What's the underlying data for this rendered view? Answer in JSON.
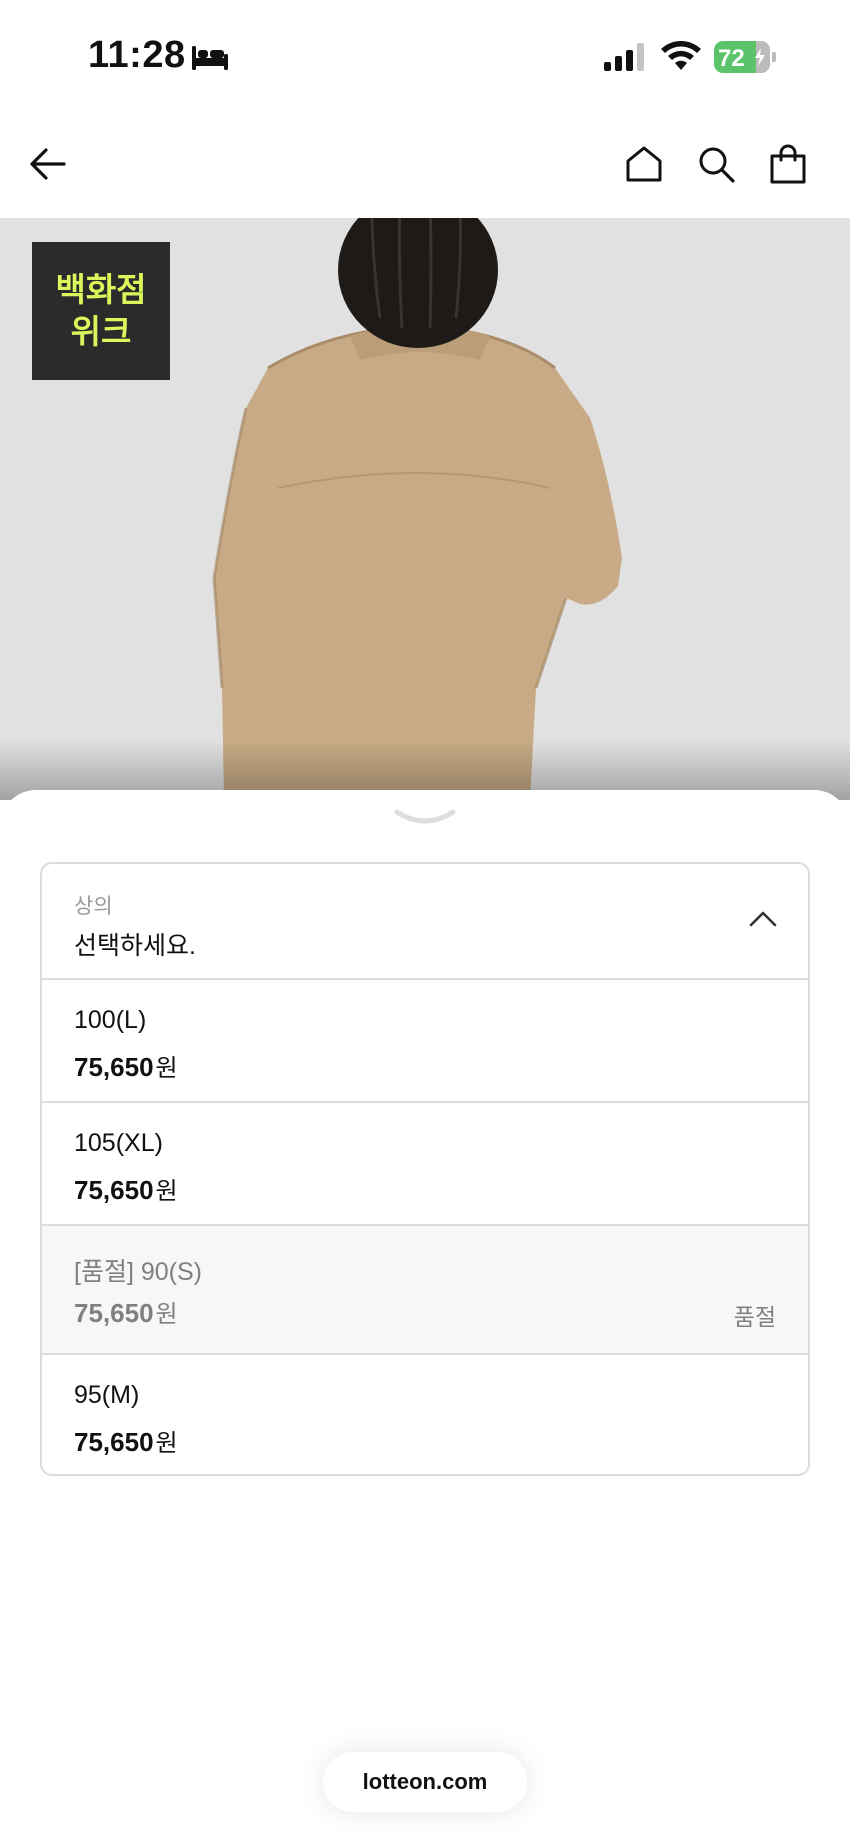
{
  "status_bar": {
    "time": "11:28",
    "battery_level": "72",
    "battery_charging": true,
    "icons": [
      "bed-icon",
      "cellular-signal-icon",
      "wifi-icon",
      "battery-icon"
    ]
  },
  "nav": {
    "icons": [
      "back-arrow-icon",
      "home-icon",
      "search-icon",
      "shopping-bag-icon"
    ]
  },
  "promo_badge": {
    "line1": "백화점",
    "line2": "위크",
    "text_color": "#d9f75a",
    "bg_color": "#2b2b2b"
  },
  "product_image": {
    "description_icon": "product-photo",
    "jacket_color": "#c8ab86"
  },
  "option_select": {
    "label": "상의",
    "placeholder": "선택하세요.",
    "expanded": true
  },
  "options": [
    {
      "name": "100(L)",
      "price": "75,650",
      "currency": "원",
      "sold_out": false,
      "status": ""
    },
    {
      "name": "105(XL)",
      "price": "75,650",
      "currency": "원",
      "sold_out": false,
      "status": ""
    },
    {
      "name": "[품절] 90(S)",
      "price": "75,650",
      "currency": "원",
      "sold_out": true,
      "status": "품절"
    },
    {
      "name": "95(M)",
      "price": "75,650",
      "currency": "원",
      "sold_out": false,
      "status": ""
    }
  ],
  "browser": {
    "url": "lotteon.com"
  }
}
